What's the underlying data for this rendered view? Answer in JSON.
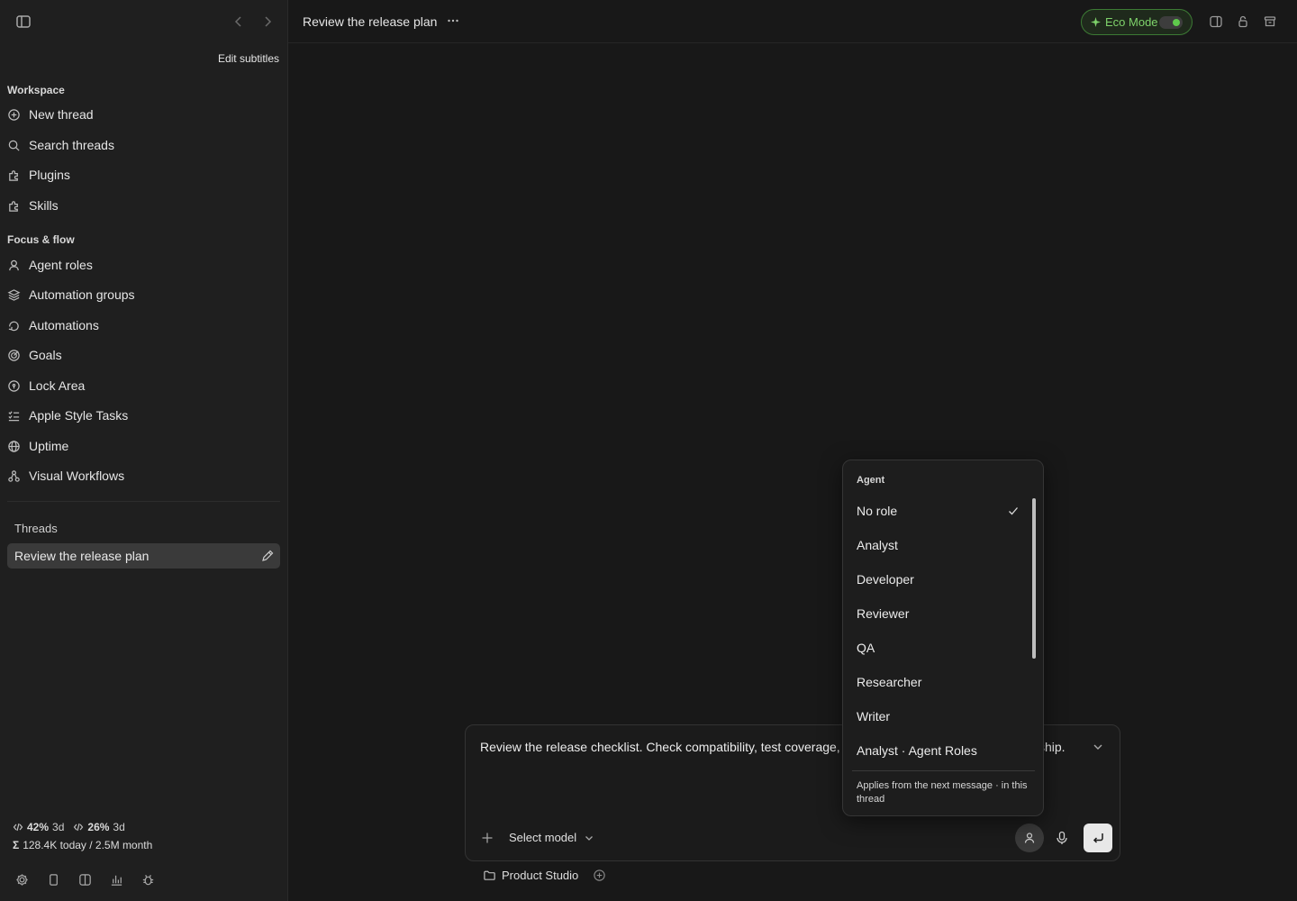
{
  "sidebar": {
    "edit_subtitles": "Edit subtitles",
    "workspace_title": "Workspace",
    "workspace_items": [
      {
        "label": "New thread",
        "icon": "plus-circle-icon"
      },
      {
        "label": "Search threads",
        "icon": "search-icon"
      },
      {
        "label": "Plugins",
        "icon": "puzzle-icon"
      },
      {
        "label": "Skills",
        "icon": "puzzle-icon"
      }
    ],
    "focus_title": "Focus & flow",
    "focus_items": [
      {
        "label": "Agent roles",
        "icon": "user-icon"
      },
      {
        "label": "Automation groups",
        "icon": "layers-icon"
      },
      {
        "label": "Automations",
        "icon": "loop-icon"
      },
      {
        "label": "Goals",
        "icon": "target-icon"
      },
      {
        "label": "Lock Area",
        "icon": "lock-circle-icon"
      },
      {
        "label": "Apple Style Tasks",
        "icon": "checklist-icon"
      },
      {
        "label": "Uptime",
        "icon": "globe-icon"
      },
      {
        "label": "Visual Workflows",
        "icon": "workflow-icon"
      }
    ],
    "threads_title": "Threads",
    "threads": [
      {
        "label": "Review the release plan",
        "active": true
      }
    ],
    "stats": {
      "stat1_pct": "42%",
      "stat1_period": "3d",
      "stat2_pct": "26%",
      "stat2_period": "3d",
      "sigma": "Σ",
      "usage": "128.4K today / 2.5M month"
    }
  },
  "header": {
    "title": "Review the release plan",
    "more_label": "···",
    "eco_label": "Eco Mode",
    "eco_on": true,
    "accent": "#5fc94c"
  },
  "composer": {
    "prompt": "Review the release checklist. Check compatibility, test coverage, ",
    "prompt_end": "ship.",
    "model_label": "Select model",
    "project_label": "Product Studio"
  },
  "agent_menu": {
    "heading": "Agent",
    "selected": "No role",
    "options": [
      "No role",
      "Analyst",
      "Developer",
      "Reviewer",
      "QA",
      "Researcher",
      "Writer",
      "Analyst · Agent Roles"
    ],
    "note": "Applies from the next message · in this thread"
  }
}
